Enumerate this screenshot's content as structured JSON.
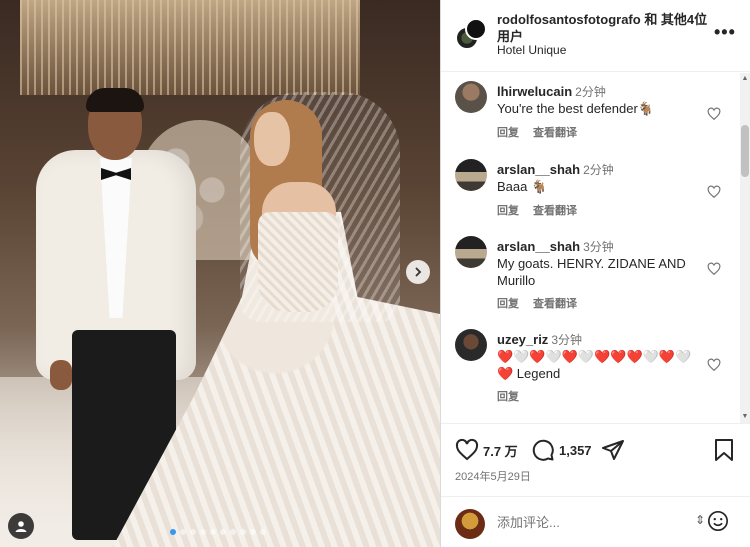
{
  "post": {
    "title": "rodolfosantosfotografo 和 其他4位用户",
    "location": "Hotel Unique",
    "more_label": "•••",
    "date": "2024年5月29日",
    "likes": "7.7 万",
    "comments_count": "1,357",
    "carousel": {
      "total": 10,
      "active_index": 0
    }
  },
  "comments": [
    {
      "user": "lhirwelucain",
      "time": "2分钟",
      "text": "You're the best defender🐐",
      "reply": "回复",
      "translate": "查看翻译"
    },
    {
      "user": "arslan__shah",
      "time": "2分钟",
      "text": "Baaa 🐐",
      "reply": "回复",
      "translate": "查看翻译"
    },
    {
      "user": "arslan__shah",
      "time": "3分钟",
      "text": "My goats. HENRY. ZIDANE AND Murillo",
      "reply": "回复",
      "translate": "查看翻译"
    },
    {
      "user": "uzey_riz",
      "time": "3分钟",
      "text": "❤️🤍❤️🤍❤️🤍❤️❤️❤️🤍❤️🤍❤️ Legend",
      "reply": "回复"
    }
  ],
  "add_comment": {
    "placeholder": "添加评论..."
  },
  "icons": {
    "more": "more-icon",
    "like": "heart-icon",
    "comment": "comment-icon",
    "share": "share-icon",
    "save": "bookmark-icon",
    "emoji": "emoji-icon",
    "tag": "user-tag-icon",
    "next": "chevron-right-icon"
  },
  "colors": {
    "heart_red": "#ed4956",
    "link_blue": "#3897f0",
    "secondary_text": "#737373"
  }
}
